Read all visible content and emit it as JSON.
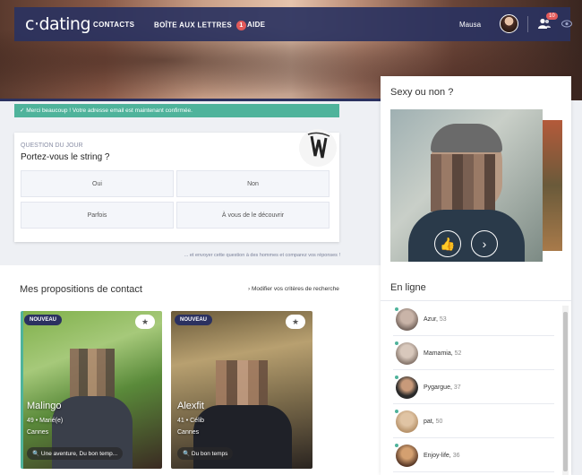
{
  "nav": {
    "logo": "c·dating",
    "items": [
      {
        "label": "CONTACTS"
      },
      {
        "label": "BOÎTE AUX LETTRES",
        "badge": "1"
      },
      {
        "label": "AIDE"
      }
    ],
    "user_name": "Mausa",
    "notif_count": "10"
  },
  "confirmation": "✓  Merci beaucoup ! Votre adresse email est maintenant confirmée.",
  "question": {
    "label": "QUESTION DU JOUR",
    "text": "Portez-vous le string ?",
    "options": [
      "Oui",
      "Non",
      "Parfois",
      "À vous de le découvrir"
    ],
    "footer": "... et envoyer cette question à des hommes et comparez vos réponses !"
  },
  "propositions": {
    "title": "Mes propositions de contact",
    "link": "› Modifier vos critères de recherche",
    "cards": [
      {
        "badge": "NOUVEAU",
        "name": "Malingo",
        "meta": "49 • Marié(e)",
        "city": "Cannes",
        "tag": "Une aventure, Du bon temp..."
      },
      {
        "badge": "NOUVEAU",
        "name": "Alexfit",
        "meta": "41 • Célib",
        "city": "Cannes",
        "tag": "Du bon temps"
      }
    ]
  },
  "sexy": {
    "title": "Sexy ou non ?"
  },
  "online": {
    "title": "En ligne",
    "users": [
      {
        "name": "Azur",
        "age": "53"
      },
      {
        "name": "Mamamia",
        "age": "52"
      },
      {
        "name": "Pygargue",
        "age": "37"
      },
      {
        "name": "pat",
        "age": "50"
      },
      {
        "name": "Enjoy-life",
        "age": "36"
      }
    ]
  },
  "colors": {
    "nav_bg": "#2a3260",
    "accent_green": "#4fb39b",
    "badge_red": "#e25a5a"
  }
}
